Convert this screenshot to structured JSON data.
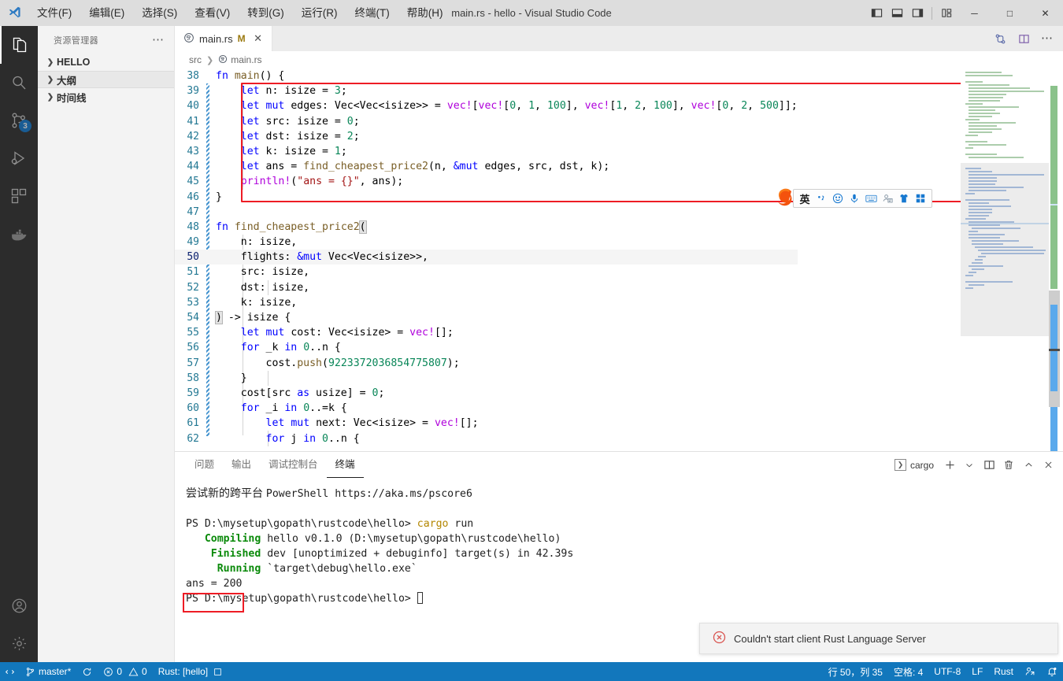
{
  "window": {
    "title": "main.rs - hello - Visual Studio Code",
    "logo_icon": "vscode-logo",
    "menu": [
      {
        "label": "文件(F)",
        "name": "menu-file"
      },
      {
        "label": "编辑(E)",
        "name": "menu-edit"
      },
      {
        "label": "选择(S)",
        "name": "menu-selection"
      },
      {
        "label": "查看(V)",
        "name": "menu-view"
      },
      {
        "label": "转到(G)",
        "name": "menu-go"
      },
      {
        "label": "运行(R)",
        "name": "menu-run"
      },
      {
        "label": "终端(T)",
        "name": "menu-terminal"
      },
      {
        "label": "帮助(H)",
        "name": "menu-help"
      }
    ],
    "layout_buttons": [
      "toggle-primary-sidebar",
      "toggle-panel",
      "toggle-secondary-sidebar",
      "customize-layout"
    ],
    "controls": {
      "minimize": "─",
      "maximize": "□",
      "close": "✕"
    }
  },
  "activitybar": {
    "items": [
      {
        "name": "explorer",
        "icon": "files-icon",
        "active": true,
        "badge": ""
      },
      {
        "name": "search",
        "icon": "search-icon",
        "active": false,
        "badge": ""
      },
      {
        "name": "source-control",
        "icon": "source-control-icon",
        "active": false,
        "badge": "3"
      },
      {
        "name": "run-and-debug",
        "icon": "debug-icon",
        "active": false,
        "badge": ""
      },
      {
        "name": "extensions",
        "icon": "extensions-icon",
        "active": false,
        "badge": ""
      },
      {
        "name": "docker",
        "icon": "docker-icon",
        "active": false,
        "badge": ""
      }
    ],
    "bottom": [
      {
        "name": "accounts",
        "icon": "account-icon"
      },
      {
        "name": "manage",
        "icon": "gear-icon"
      }
    ]
  },
  "sidebar": {
    "title": "资源管理器",
    "more_label": "⋯",
    "sections": [
      {
        "label": "HELLO",
        "expanded": false,
        "highlight": false
      },
      {
        "label": "大纲",
        "expanded": false,
        "highlight": true
      },
      {
        "label": "时间线",
        "expanded": false,
        "highlight": false
      }
    ]
  },
  "editor": {
    "tab": {
      "filename": "main.rs",
      "modified_badge": "M",
      "close": "✕",
      "icon": "rust-file-icon"
    },
    "tab_actions": [
      {
        "name": "split-editor",
        "icon": "split-editor-icon"
      },
      {
        "name": "more-actions",
        "icon": "ellipsis-icon"
      },
      {
        "name": "run-code",
        "icon": "run-icon"
      }
    ],
    "breadcrumb": [
      "src",
      "main.rs"
    ],
    "first_line": 38,
    "lines": [
      {
        "n": 38,
        "text": "fn main() {"
      },
      {
        "n": 39,
        "text": "    let n: isize = 3;"
      },
      {
        "n": 40,
        "text": "    let mut edges: Vec<Vec<isize>> = vec![vec![0, 1, 100], vec![1, 2, 100], vec![0, 2, 500]];"
      },
      {
        "n": 41,
        "text": "    let src: isize = 0;"
      },
      {
        "n": 42,
        "text": "    let dst: isize = 2;"
      },
      {
        "n": 43,
        "text": "    let k: isize = 1;"
      },
      {
        "n": 44,
        "text": "    let ans = find_cheapest_price2(n, &mut edges, src, dst, k);"
      },
      {
        "n": 45,
        "text": "    println!(\"ans = {}\", ans);"
      },
      {
        "n": 46,
        "text": "}"
      },
      {
        "n": 47,
        "text": ""
      },
      {
        "n": 48,
        "text": "fn find_cheapest_price2("
      },
      {
        "n": 49,
        "text": "    n: isize,"
      },
      {
        "n": 50,
        "text": "    flights: &mut Vec<Vec<isize>>,"
      },
      {
        "n": 51,
        "text": "    src: isize,"
      },
      {
        "n": 52,
        "text": "    dst: isize,"
      },
      {
        "n": 53,
        "text": "    k: isize,"
      },
      {
        "n": 54,
        "text": ") -> isize {"
      },
      {
        "n": 55,
        "text": "    let mut cost: Vec<isize> = vec![];"
      },
      {
        "n": 56,
        "text": "    for _k in 0..n {"
      },
      {
        "n": 57,
        "text": "        cost.push(9223372036854775807);"
      },
      {
        "n": 58,
        "text": "    }"
      },
      {
        "n": 59,
        "text": "    cost[src as usize] = 0;"
      },
      {
        "n": 60,
        "text": "    for _i in 0..=k {"
      },
      {
        "n": 61,
        "text": "        let mut next: Vec<isize> = vec![];"
      },
      {
        "n": 62,
        "text": "        for j in 0..n {"
      }
    ],
    "highlighted_line": 50,
    "annotation_box_lines": [
      39,
      45
    ]
  },
  "ime": {
    "mode_label": "英",
    "icons": [
      "sogou-logo",
      "input-mode",
      "punctuation",
      "emoji",
      "voice",
      "soft-keyboard",
      "screenshot",
      "skin",
      "toolbox"
    ]
  },
  "panel": {
    "tabs": [
      {
        "label": "问题",
        "name": "tab-problems",
        "active": false
      },
      {
        "label": "输出",
        "name": "tab-output",
        "active": false
      },
      {
        "label": "调试控制台",
        "name": "tab-debug-console",
        "active": false
      },
      {
        "label": "终端",
        "name": "tab-terminal",
        "active": true
      }
    ],
    "terminal_selector": "cargo",
    "actions": [
      {
        "name": "new-terminal",
        "icon": "plus-icon"
      },
      {
        "name": "terminal-dropdown",
        "icon": "chevron-down-icon"
      },
      {
        "name": "split-terminal",
        "icon": "split-icon"
      },
      {
        "name": "kill-terminal",
        "icon": "trash-icon"
      },
      {
        "name": "maximize-panel",
        "icon": "chevron-up-icon"
      },
      {
        "name": "close-panel",
        "icon": "close-icon"
      }
    ],
    "terminal_lines": [
      {
        "segments": [
          {
            "t": "尝试新的跨平台 ",
            "c": "cn"
          },
          {
            "t": "PowerShell https://aka.ms/pscore6",
            "c": ""
          }
        ]
      },
      {
        "segments": [
          {
            "t": "",
            "c": ""
          }
        ]
      },
      {
        "segments": [
          {
            "t": "PS D:\\mysetup\\gopath\\rustcode\\hello> ",
            "c": ""
          },
          {
            "t": "cargo",
            "c": "yellow"
          },
          {
            "t": " run",
            "c": ""
          }
        ]
      },
      {
        "segments": [
          {
            "t": "   ",
            "c": ""
          },
          {
            "t": "Compiling",
            "c": "green"
          },
          {
            "t": " hello v0.1.0 (D:\\mysetup\\gopath\\rustcode\\hello)",
            "c": ""
          }
        ]
      },
      {
        "segments": [
          {
            "t": "    ",
            "c": ""
          },
          {
            "t": "Finished",
            "c": "green"
          },
          {
            "t": " dev [unoptimized + debuginfo] target(s) in 42.39s",
            "c": ""
          }
        ]
      },
      {
        "segments": [
          {
            "t": "     ",
            "c": ""
          },
          {
            "t": "Running",
            "c": "green"
          },
          {
            "t": " `target\\debug\\hello.exe`",
            "c": ""
          }
        ]
      },
      {
        "segments": [
          {
            "t": "ans = 200",
            "c": ""
          }
        ]
      },
      {
        "segments": [
          {
            "t": "PS D:\\mysetup\\gopath\\rustcode\\hello> ",
            "c": ""
          },
          {
            "t": "█",
            "c": "cursor"
          }
        ]
      }
    ],
    "highlighted_output": "ans = 200"
  },
  "notification": {
    "icon": "error-circle-icon",
    "message": "Couldn't start client Rust Language Server"
  },
  "statusbar": {
    "left": [
      {
        "name": "remote-indicator",
        "icon": "remote-icon",
        "label": ""
      },
      {
        "name": "branch",
        "icon": "git-branch-icon",
        "label": "master*"
      },
      {
        "name": "sync-changes",
        "icon": "sync-icon",
        "label": ""
      },
      {
        "name": "problems",
        "icon": "error-warning-icon",
        "label": "0  0",
        "errors": "0",
        "warnings": "0"
      },
      {
        "name": "rust-analyzer-status",
        "icon": "",
        "label": "Rust: [hello]"
      },
      {
        "name": "rust-extra",
        "icon": "square-icon",
        "label": ""
      }
    ],
    "right": [
      {
        "name": "cursor-position",
        "label": "行 50，列 35"
      },
      {
        "name": "indentation",
        "label": "空格: 4"
      },
      {
        "name": "encoding",
        "label": "UTF-8"
      },
      {
        "name": "eol",
        "label": "LF"
      },
      {
        "name": "language-mode",
        "label": "Rust"
      },
      {
        "name": "live-share",
        "icon": "live-share-icon",
        "label": ""
      },
      {
        "name": "notifications",
        "icon": "bell-icon",
        "label": ""
      }
    ]
  },
  "colors": {
    "status_bar": "#1277bc",
    "activity_bar": "#2c2c2c",
    "sidebar": "#f3f3f3",
    "annotation_red": "#ee1c25",
    "badge_blue": "#0e7ad4",
    "keyword": "#0000ff",
    "number": "#098658",
    "string": "#a31515",
    "function": "#795e26",
    "macro": "#af00db",
    "linenum": "#237893"
  }
}
